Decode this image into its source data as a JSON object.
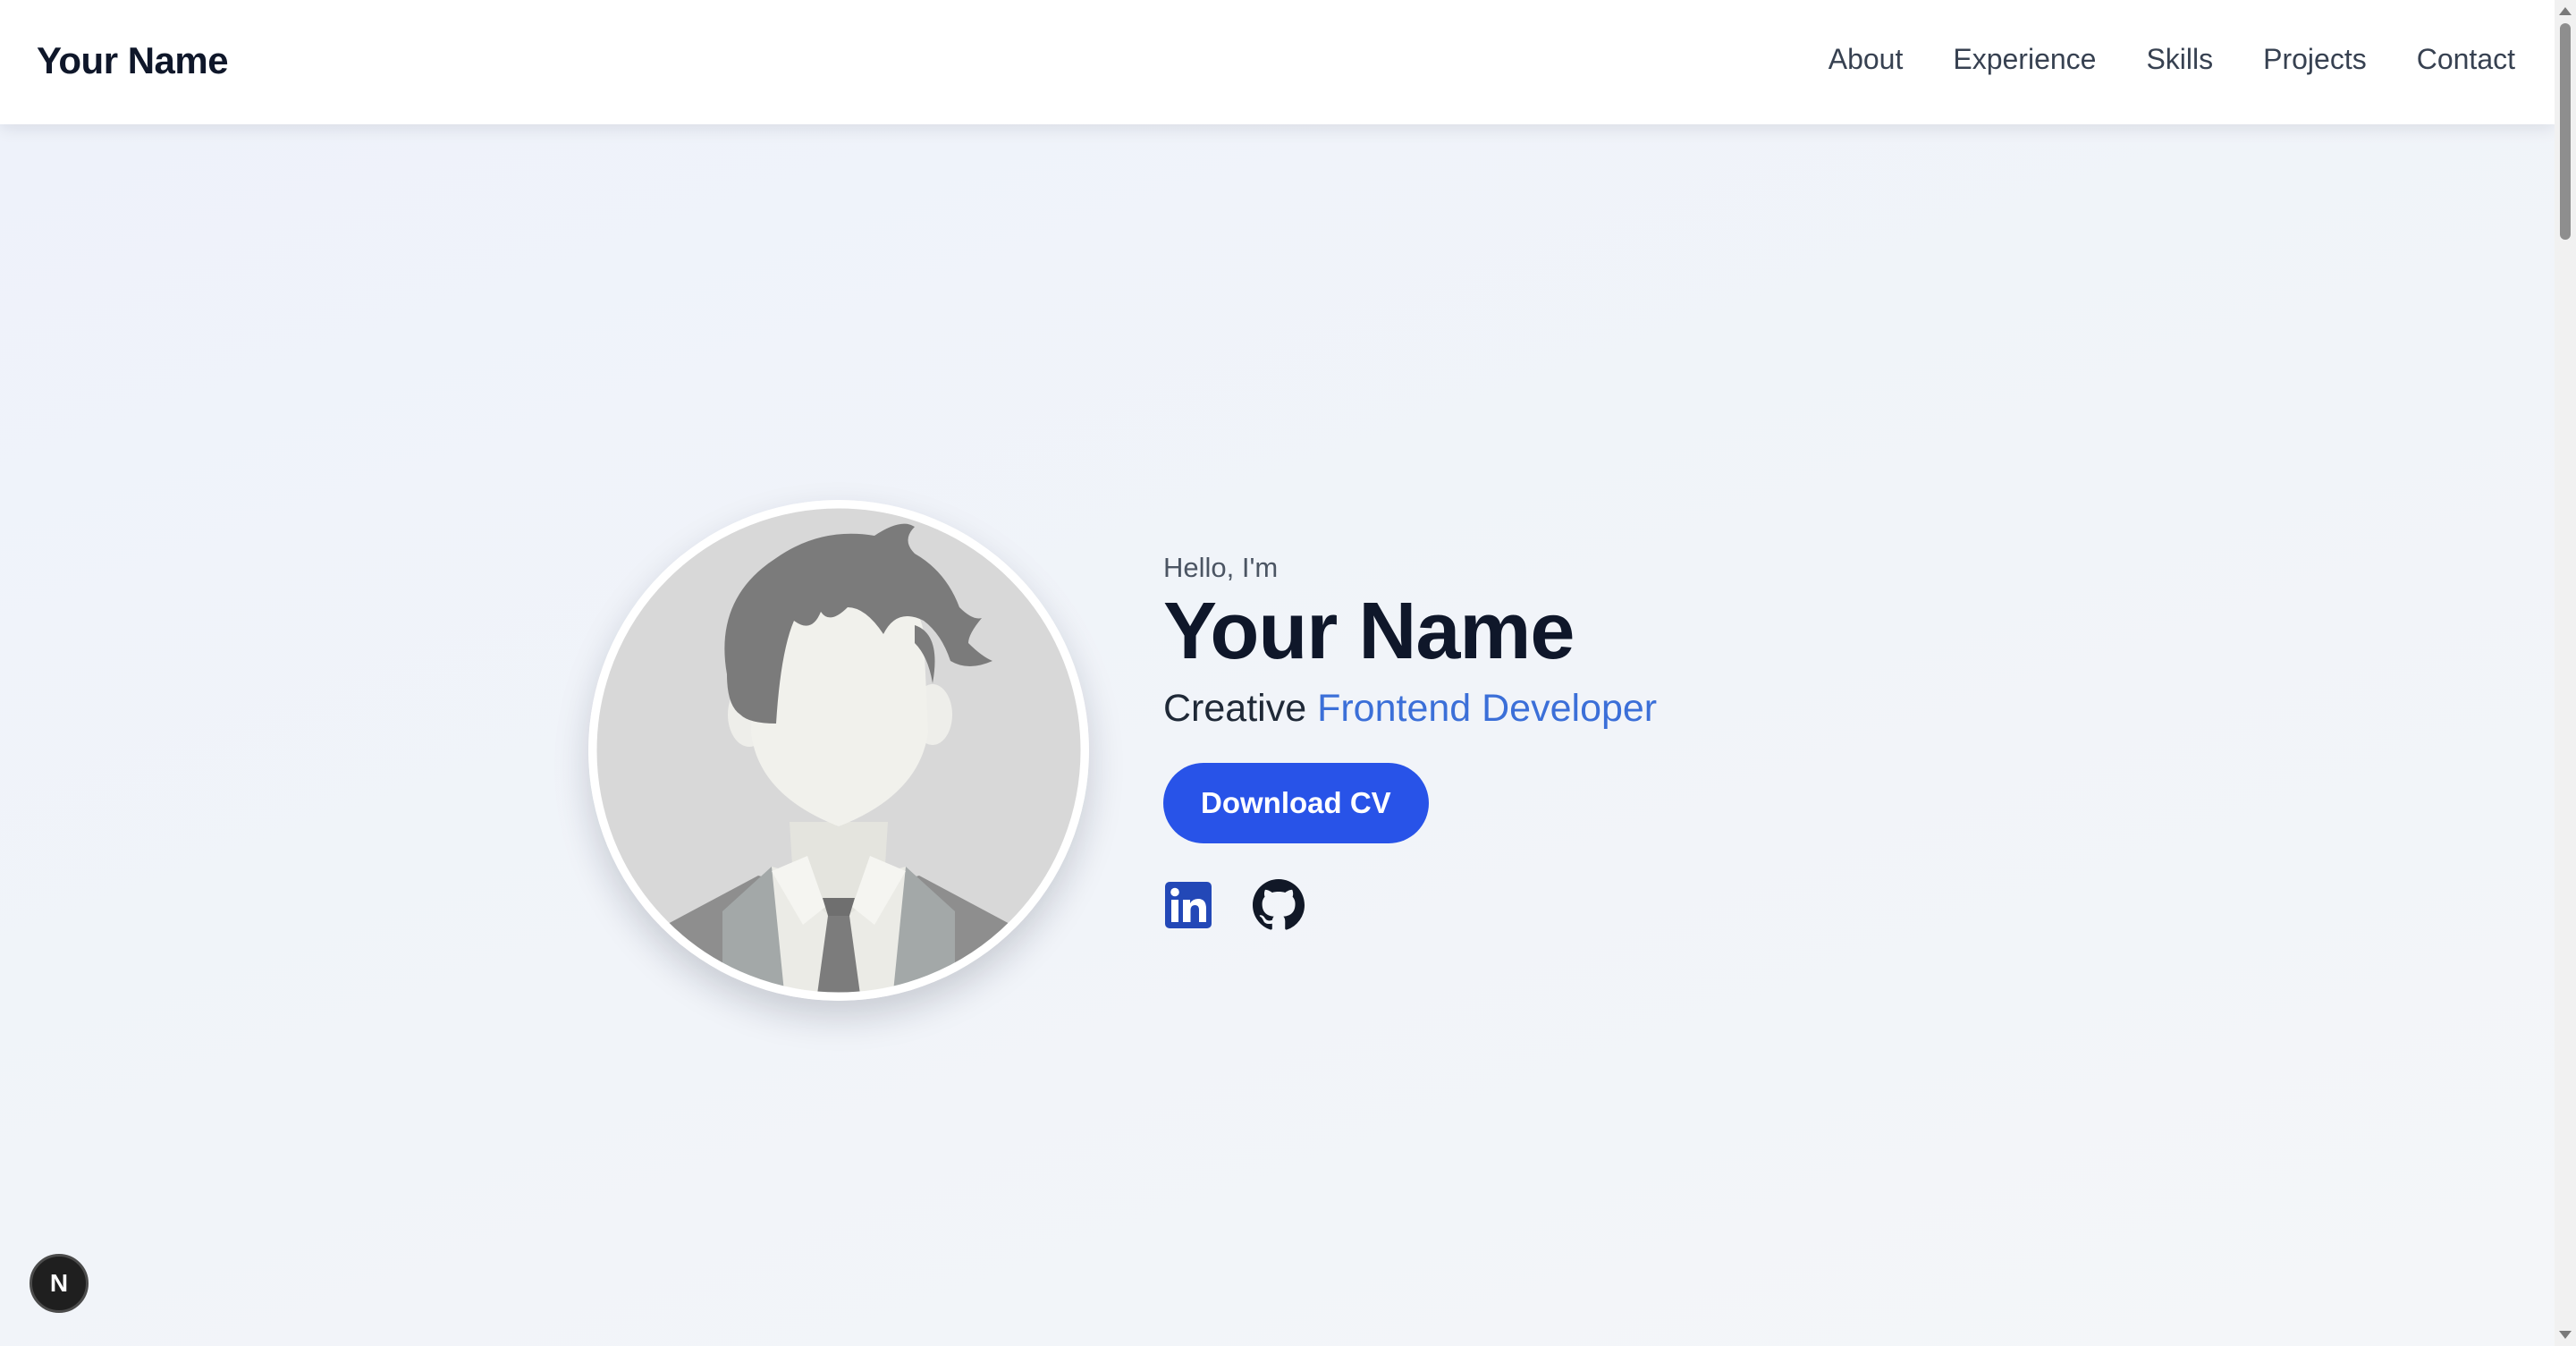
{
  "navbar": {
    "brand": "Your Name",
    "links": [
      "About",
      "Experience",
      "Skills",
      "Projects",
      "Contact"
    ]
  },
  "hero": {
    "greeting": "Hello, I'm",
    "name": "Your Name",
    "role_prefix": "Creative",
    "role_highlight": "Frontend Developer",
    "cta_label": "Download CV",
    "socials": [
      "linkedin-icon",
      "github-icon"
    ]
  },
  "floating_badge": {
    "letter": "N"
  },
  "colors": {
    "accent": "#2853e8",
    "role_accent": "#3b6fd8",
    "heading": "#0f172a",
    "background": "#f0f3f9"
  }
}
